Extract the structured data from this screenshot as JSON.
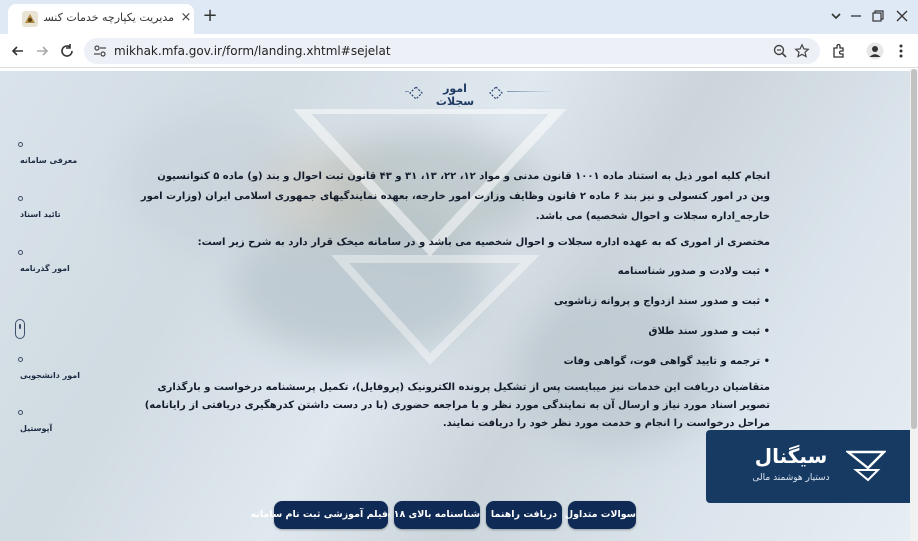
{
  "browser": {
    "tab_title": "مدیریت یکپارچه خدمات کنسولی",
    "tab_close": "×",
    "new_tab": "+",
    "url": "mikhak.mfa.gov.ir/form/landing.xhtml#sejelat"
  },
  "page": {
    "section_title": "امور سجلات",
    "sidenav": [
      {
        "label": "معرفی سامانه"
      },
      {
        "label": "تائید اسناد"
      },
      {
        "label": "امور گذرنامه"
      },
      {
        "label": "امور دانشجویی"
      },
      {
        "label": "آپوستیل"
      }
    ],
    "content": {
      "intro": "انجام کلیه امور ذیل به استناد ماده ۱۰۰۱ قانون مدنی و مواد ۱۲، ۲۲، ۱۳، ۳۱ و ۴۳ قانون ثبت احوال و بند (و) ماده ۵ کنوانسیون وین در امور کنسولی و نیز بند ۶ ماده ۲ قانون وظایف وزارت امور خارجه، بعهده نمایندگیهای جمهوری اسلامی ایران (وزارت امور خارجه_اداره سجلات و احوال شخصیه) می باشد.",
      "lead": "مختصری از اموری که به عهده اداره سجلات و احوال شخصیه می باشد و در سامانه میخک قرار دارد به شرح زیر است:",
      "bullets": [
        "• ثبت ولادت و صدور شناسنامه",
        "• ثبت و صدور سند ازدواج و پروانه زناشویی",
        "• ثبت و صدور سند طلاق",
        "• ترجمه و تایید گواهی فوت، گواهی وفات"
      ],
      "outro": "متقاضیان دریافت این خدمات نیز میبایست پس از تشکیل پرونده الکترونیک (پروفایل)، تکمیل پرسشنامه درخواست و بارگذاری تصویر اسناد مورد نیاز و ارسال آن به نمایندگی مورد نظر و با مراجعه حضوری (با در دست داشتن کدرهگیری دریافتی از رایانامه) مراحل درخواست را انجام و خدمت مورد نظر خود را دریافت نمایند."
    },
    "buttons": {
      "faq": "سوالات متداول",
      "guide": "دریافت راهنما",
      "id_over18": "شناسنامه بالای ۱۸ سال",
      "tutorial": "فیلم آموزشی ثبت نام سامانه"
    }
  },
  "signal_widget": {
    "title": "سیگنال",
    "subtitle": "دستیار هوشمند مالی"
  },
  "colors": {
    "navy": "#0f2a55",
    "widget": "#173a63",
    "tabstrip": "#dfe8f5"
  }
}
